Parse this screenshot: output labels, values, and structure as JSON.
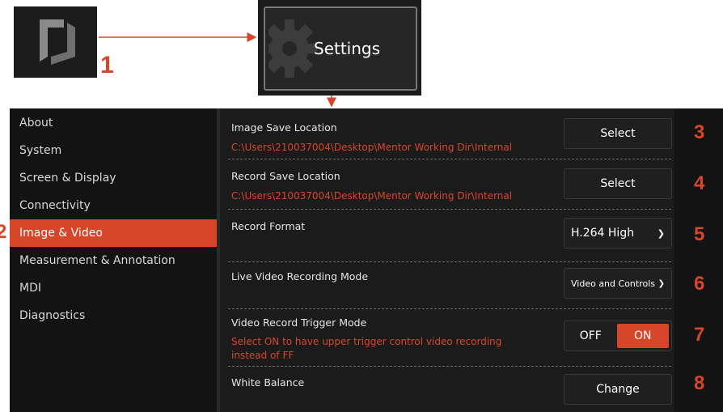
{
  "callouts": {
    "app_step": "1",
    "settings_label": "Settings",
    "sidebar_step": "2",
    "row_steps": [
      "3",
      "4",
      "5",
      "6",
      "7",
      "8"
    ]
  },
  "sidebar": {
    "items": [
      {
        "label": "About"
      },
      {
        "label": "System"
      },
      {
        "label": "Screen & Display"
      },
      {
        "label": "Connectivity"
      },
      {
        "label": "Image & Video",
        "active": true
      },
      {
        "label": "Measurement & Annotation"
      },
      {
        "label": "MDI"
      },
      {
        "label": "Diagnostics"
      }
    ]
  },
  "settings": {
    "image_save": {
      "label": "Image Save Location",
      "path": "C:\\Users\\210037004\\Desktop\\Mentor Working Dir\\Internal",
      "button": "Select"
    },
    "record_save": {
      "label": "Record Save Location",
      "path": "C:\\Users\\210037004\\Desktop\\Mentor Working Dir\\Internal",
      "button": "Select"
    },
    "record_format": {
      "label": "Record Format",
      "value": "H.264 High"
    },
    "live_mode": {
      "label": "Live Video Recording Mode",
      "value": "Video and Controls"
    },
    "trigger_mode": {
      "label": "Video Record Trigger Mode",
      "description": "Select ON to have upper trigger control video recording instead of FF",
      "off_label": "OFF",
      "on_label": "ON",
      "state": "ON"
    },
    "white_balance": {
      "label": "White Balance",
      "button": "Change"
    }
  },
  "colors": {
    "accent": "#d8462a",
    "panel": "#131313",
    "content": "#1b1b1b"
  }
}
